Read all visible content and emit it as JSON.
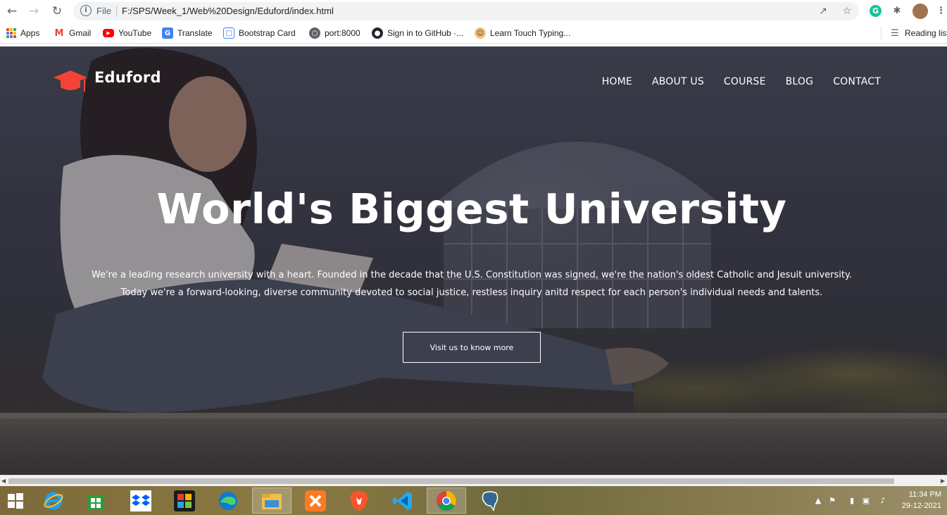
{
  "browser": {
    "back_icon": "arrow-left-icon",
    "forward_icon": "arrow-right-icon",
    "reload_icon": "reload-icon",
    "scheme_label": "File",
    "url": "F:/SPS/Week_1/Web%20Design/Eduford/index.html",
    "bookmarks": [
      {
        "label": "Apps",
        "icon": "apps-grid-icon"
      },
      {
        "label": "Gmail",
        "icon": "gmail-icon"
      },
      {
        "label": "YouTube",
        "icon": "youtube-icon"
      },
      {
        "label": "Translate",
        "icon": "translate-icon"
      },
      {
        "label": "Bootstrap Card",
        "icon": "bootstrap-icon"
      },
      {
        "label": "port:8000",
        "icon": "globe-icon"
      },
      {
        "label": "Sign in to GitHub ·...",
        "icon": "github-icon"
      },
      {
        "label": "Learn Touch Typing...",
        "icon": "typing-icon"
      }
    ],
    "reading_list_label": "Reading list",
    "grammarly_letter": "G"
  },
  "site": {
    "brand": "Eduford",
    "brand_color": "#f44336",
    "nav": [
      "HOME",
      "ABOUT US",
      "COURSE",
      "BLOG",
      "CONTACT"
    ],
    "hero": {
      "title": "World's Biggest University",
      "line1": "We're a leading research university with a heart. Founded in the decade that the U.S. Constitution was signed, we're the nation's oldest Catholic and Jesuit university.",
      "line2": "Today we're a forward-looking, diverse community devoted to social justice, restless inquiry anitd respect for each person's individual needs and talents.",
      "cta": "Visit us to know more"
    }
  },
  "taskbar": {
    "apps": [
      "internet-explorer-icon",
      "microsoft-store-icon",
      "dropbox-icon",
      "puzzle-app-icon",
      "edge-icon",
      "file-explorer-icon",
      "xampp-icon",
      "brave-icon",
      "vscode-icon",
      "chrome-icon",
      "postgresql-icon"
    ],
    "time": "11:34 PM",
    "date": "29-12-2021"
  }
}
